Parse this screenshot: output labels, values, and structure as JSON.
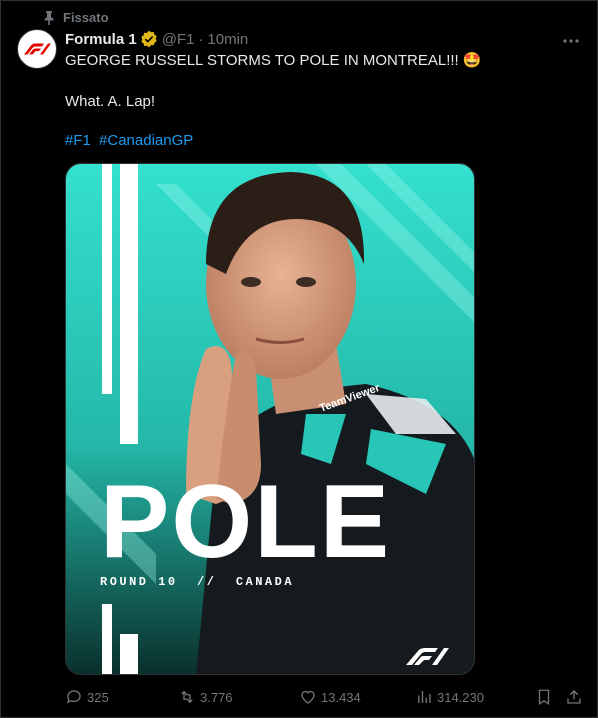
{
  "pinned": {
    "label": "Fissato"
  },
  "author": {
    "name": "Formula 1",
    "handle": "@F1",
    "separator": "·",
    "time": "10min",
    "verified_color": "#e2b719",
    "avatar_brand_color": "#e10600"
  },
  "post": {
    "line1": "GEORGE RUSSELL STORMS TO POLE IN MONTREAL!!!",
    "line1_emoji": "🤩",
    "line2": "What. A. Lap!",
    "hashtags": [
      "#F1",
      "#CanadianGP"
    ]
  },
  "media": {
    "headline": "POLE",
    "subtitle": "ROUND 10  //  CANADA",
    "logo_text": "F1",
    "jersey_text": "TeamViewer",
    "accent_color": "#2fd9c8"
  },
  "actions": {
    "replies": "325",
    "reposts": "3.776",
    "likes": "13.434",
    "views": "314.230"
  },
  "icons": [
    "pin-icon",
    "verified-icon",
    "more-icon",
    "reply-icon",
    "repost-icon",
    "like-icon",
    "views-icon",
    "bookmark-icon",
    "share-icon"
  ],
  "colors": {
    "background": "#000000",
    "text": "#e7e9ea",
    "secondary": "#71767b",
    "link": "#1d9bf0"
  }
}
